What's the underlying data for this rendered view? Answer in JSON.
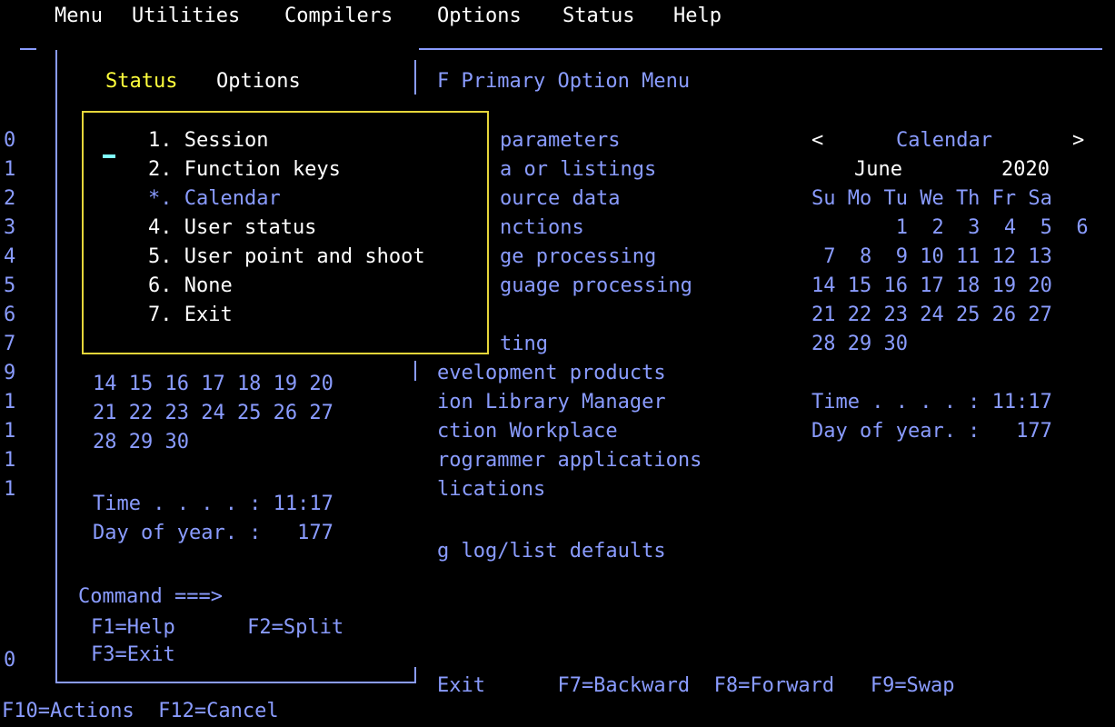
{
  "menubar": {
    "items": [
      "Menu",
      "Utilities",
      "Compilers",
      "Options",
      "Status",
      "Help"
    ]
  },
  "status_window": {
    "tabs": {
      "status": "Status",
      "options": "Options"
    },
    "hidden_calendar_rows": [
      "14 15 16 17 18 19 20",
      "21 22 23 24 25 26 27",
      "28 29 30"
    ],
    "time_line": "Time . . . . : 11:17",
    "doy_line": "Day of year. :   177",
    "command_label": "Command ===>",
    "keys1": "F1=Help      F2=Split",
    "keys2": "F3=Exit"
  },
  "status_menu": {
    "items": [
      "1. Session",
      "2. Function keys",
      "*. Calendar",
      "4. User status",
      "5. User point and shoot",
      "6. None",
      "7. Exit"
    ]
  },
  "left_margin": [
    "0",
    "1",
    "2",
    "3",
    "4",
    "5",
    "6",
    "7",
    "9",
    "1",
    "1",
    "1",
    "1",
    "0"
  ],
  "primary_panel": {
    "title": "F Primary Option Menu",
    "lines": [
      "parameters",
      "a or listings",
      "ource data",
      "nctions",
      "ge processing",
      "guage processing",
      "ting",
      "evelopment products",
      "ion Library Manager",
      "ction Workplace",
      "rogrammer applications",
      "lications",
      "g log/list defaults"
    ],
    "footer": "Exit      F7=Backward  F8=Forward   F9=Swap"
  },
  "calendar": {
    "prev": "<",
    "title": "Calendar",
    "next": ">",
    "month": "June",
    "year": "2020",
    "header": "Su Mo Tu We Th Fr Sa",
    "weeks": [
      "       1  2  3  4  5  6",
      " 7  8  9 10 11 12 13",
      "14 15 16 17 18 19 20",
      "21 22 23 24 25 26 27",
      "28 29 30"
    ],
    "time_line": "Time . . . . : 11:17",
    "doy_line": "Day of year. :   177"
  },
  "bottom_bar": "F10=Actions  F12=Cancel"
}
